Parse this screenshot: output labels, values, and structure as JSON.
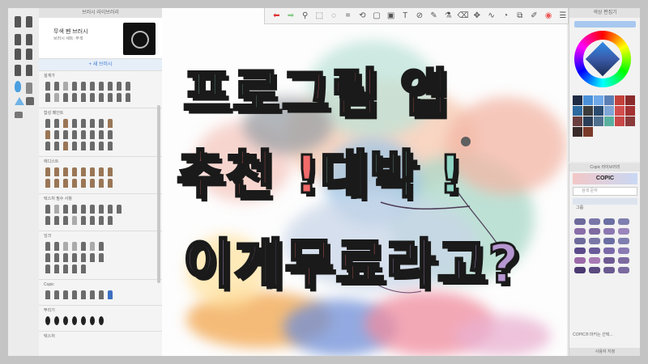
{
  "headline": {
    "line1": [
      {
        "text": "프로",
        "color": "mint"
      },
      {
        "text": " 그림 앱",
        "color": "coral"
      }
    ],
    "line2": [
      {
        "text": "추천 ! ",
        "color": "coral"
      },
      {
        "text": "대박 !",
        "color": "mint"
      }
    ],
    "line3": [
      {
        "text": "이게 ",
        "color": "lilac"
      },
      {
        "text": "무료",
        "color": "coral"
      },
      {
        "text": "라고?",
        "color": "lilac"
      }
    ]
  },
  "brush_library": {
    "title": "브러시 라이브러리",
    "current_brush": "무색 펜 브러시",
    "current_sub": "브러시 세트: 무색",
    "new_brush_button": "새 브러시",
    "categories": [
      "설계가",
      "합성 페인트",
      "에디스트",
      "텍스처 필수 사항",
      "잉크",
      "Copic",
      "뿌리기",
      "텍스처"
    ]
  },
  "color_panel": {
    "title": "색상 편집기",
    "swatches": [
      "#1f2a44",
      "#4a90d9",
      "#6fa8e8",
      "#5b7fb5",
      "#c2413a",
      "#8a2b2b",
      "#2d6a9f",
      "#3c3c3c",
      "#2b4b6f",
      "#7fa6d6",
      "#d24e4e",
      "#a33232",
      "#6b3f3f",
      "#2c3e57",
      "#4f6f8f",
      "#5ab0a0",
      "#c84848",
      "#8b3a3a",
      "#3a2a2a",
      "#7a3a2a"
    ]
  },
  "copic_panel": {
    "title": "Copic 라이브러리",
    "logo": "COPIC",
    "search_placeholder": "검색 문자",
    "tab": "그룹",
    "note": "COPIC® 마커는 선택...",
    "footer": "사용자 지정",
    "pen_colors": [
      "#6d6a9c",
      "#7a77a8",
      "#6a6ea2",
      "#7f7fb0",
      "#8a6ea8",
      "#7e6aa0",
      "#8c78b0",
      "#9a86bc",
      "#6d6a9c",
      "#7a77a8",
      "#6a6ea2",
      "#7f7fb0",
      "#5a4a8a",
      "#6a5a9a",
      "#7a6aa8",
      "#8a7ab4",
      "#9a6aa8",
      "#a87ab4",
      "#6d5a92",
      "#7c6aa0",
      "#4a3a72",
      "#5a4a80",
      "#6a5a90",
      "#7a6aa0"
    ]
  },
  "toolbar": {
    "icons": [
      "undo-icon",
      "redo-icon",
      "zoom-icon",
      "select-icon",
      "lasso-icon",
      "crop-icon",
      "transform-icon",
      "rect-select-icon",
      "fill-icon",
      "text-icon",
      "ruler-icon",
      "pen-icon",
      "eyedropper-icon",
      "eraser-icon",
      "move-icon",
      "curve-icon",
      "shape-icon",
      "layer-icon",
      "brush-icon",
      "color-icon",
      "menu-icon"
    ]
  }
}
